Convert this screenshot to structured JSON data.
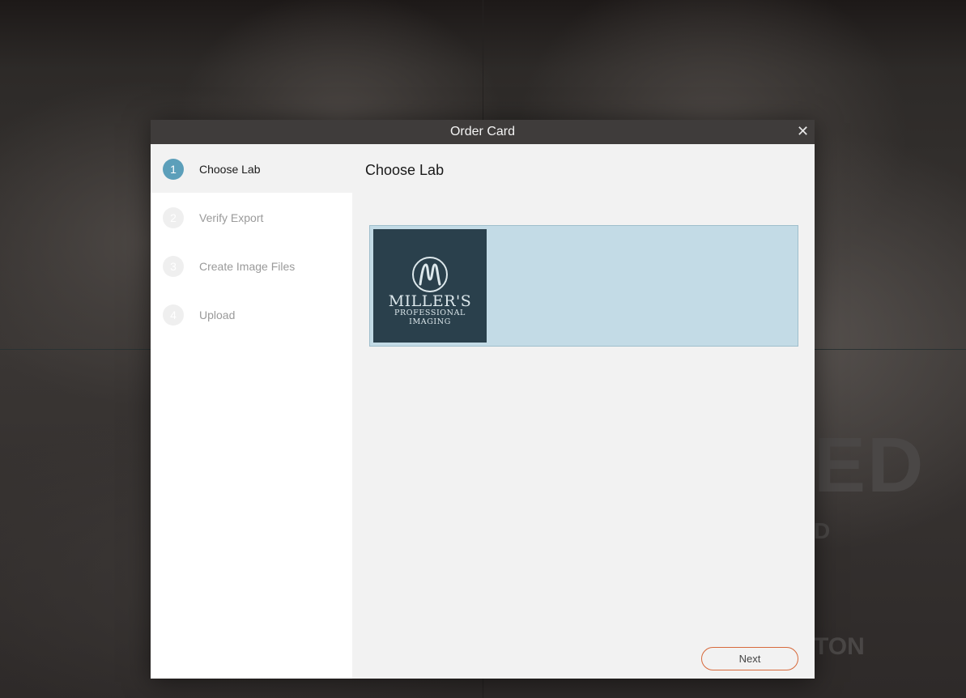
{
  "background": {
    "text_large": "ED",
    "text_medium": "D",
    "text_bottom": "TON"
  },
  "dialog": {
    "title": "Order Card",
    "close_glyph": "✕"
  },
  "steps": [
    {
      "number": "1",
      "label": "Choose Lab",
      "state": "active"
    },
    {
      "number": "2",
      "label": "Verify Export",
      "state": "inactive"
    },
    {
      "number": "3",
      "label": "Create Image Files",
      "state": "inactive"
    },
    {
      "number": "4",
      "label": "Upload",
      "state": "inactive"
    }
  ],
  "content": {
    "heading": "Choose Lab",
    "lab": {
      "logo_name": "MILLER'S",
      "logo_sub": "PROFESSIONAL IMAGING",
      "logo_mark": "M",
      "selected": true
    },
    "next_label": "Next"
  },
  "colors": {
    "accent": "#5c9fba",
    "selection": "#c3dbe6",
    "next_border": "#d76a3c",
    "titlebar": "#3f3c3b"
  }
}
